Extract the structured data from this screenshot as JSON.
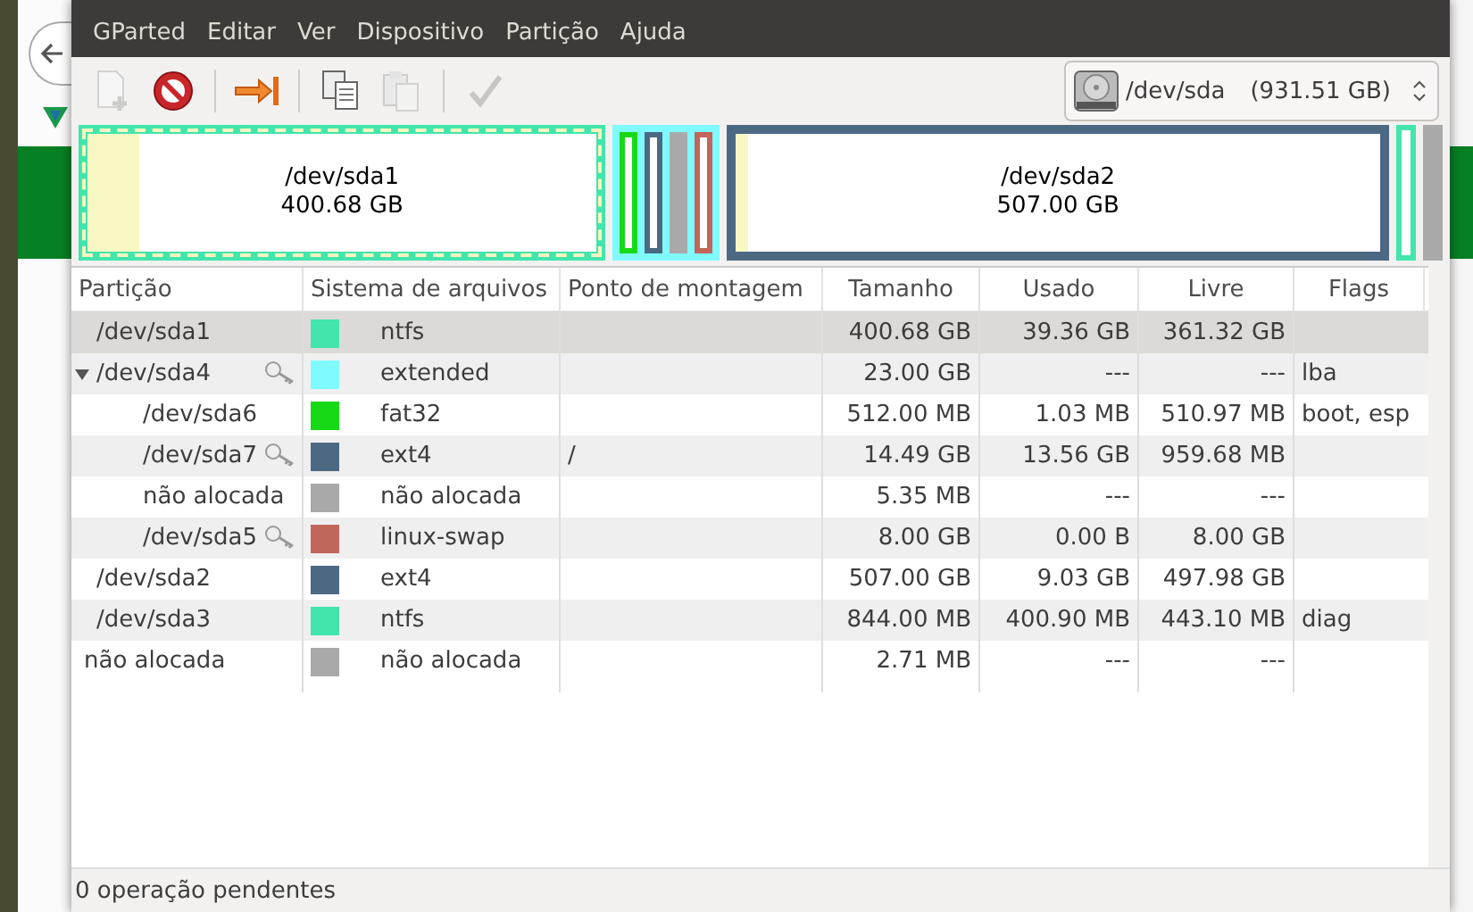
{
  "menu": [
    "GParted",
    "Editar",
    "Ver",
    "Dispositivo",
    "Partição",
    "Ajuda"
  ],
  "toolbar": [
    {
      "kind": "new",
      "disabled": true
    },
    {
      "kind": "delete",
      "disabled": false
    },
    {
      "kind": "sep"
    },
    {
      "kind": "resize",
      "disabled": false
    },
    {
      "kind": "sep"
    },
    {
      "kind": "copy",
      "disabled": false
    },
    {
      "kind": "paste",
      "disabled": true
    },
    {
      "kind": "sep"
    },
    {
      "kind": "apply",
      "disabled": true
    }
  ],
  "device": {
    "name": "/dev/sda",
    "size": "(931.51 GB)"
  },
  "graph": [
    {
      "kind": "partition",
      "label": "/dev/sda1",
      "size": "400.68 GB",
      "color": "#42e5ac",
      "level": 0.1,
      "selected": true
    },
    {
      "kind": "extended",
      "color": "#7ffbff",
      "children": [
        {
          "kind": "slot",
          "color": "#18d918"
        },
        {
          "kind": "slot",
          "color": "#4b6983"
        },
        {
          "kind": "unallocated",
          "color": "#a9a9a9"
        },
        {
          "kind": "slot",
          "color": "#c1665a"
        }
      ]
    },
    {
      "kind": "partition",
      "label": "/dev/sda2",
      "size": "507.00 GB",
      "color": "#4b6983",
      "level": 0.02,
      "selected": false
    },
    {
      "kind": "slot",
      "color": "#42e5ac"
    },
    {
      "kind": "unallocated",
      "color": "#a9a9a9"
    }
  ],
  "table": {
    "columns": [
      "Partição",
      "Sistema de arquivos",
      "Ponto de montagem",
      "Tamanho",
      "Usado",
      "Livre",
      "Flags"
    ],
    "rows": [
      {
        "partition": "/dev/sda1",
        "busy": false,
        "color": "#42e5ac",
        "filesystem": "ntfs",
        "size": "400.68 GB",
        "used": "39.36 GB",
        "free": "361.32 GB",
        "selected": true
      },
      {
        "partition": "/dev/sda4",
        "busy": true,
        "color": "#7ffbff",
        "filesystem": "extended",
        "size": "23.00 GB",
        "used": "---",
        "free": "---",
        "flags": "lba",
        "selected": false,
        "expanded": true,
        "children": [
          {
            "partition": "/dev/sda6",
            "busy": false,
            "color": "#18d918",
            "filesystem": "fat32",
            "size": "512.00 MB",
            "used": "1.03 MB",
            "free": "510.97 MB",
            "flags": "boot, esp",
            "selected": false
          },
          {
            "partition": "/dev/sda7",
            "busy": true,
            "color": "#4b6983",
            "filesystem": "ext4",
            "mount": "/",
            "size": "14.49 GB",
            "used": "13.56 GB",
            "free": "959.68 MB",
            "selected": false
          },
          {
            "partition": "não alocada",
            "busy": false,
            "color": "#a9a9a9",
            "filesystem": "não alocada",
            "size": "5.35 MB",
            "used": "---",
            "free": "---",
            "selected": false
          },
          {
            "partition": "/dev/sda5",
            "busy": true,
            "color": "#c1665a",
            "filesystem": "linux-swap",
            "size": "8.00 GB",
            "used": "0.00 B",
            "free": "8.00 GB",
            "selected": false
          }
        ]
      },
      {
        "partition": "/dev/sda2",
        "busy": false,
        "color": "#4b6983",
        "filesystem": "ext4",
        "size": "507.00 GB",
        "used": "9.03 GB",
        "free": "497.98 GB",
        "selected": false
      },
      {
        "partition": "/dev/sda3",
        "busy": false,
        "color": "#42e5ac",
        "filesystem": "ntfs",
        "size": "844.00 MB",
        "used": "400.90 MB",
        "free": "443.10 MB",
        "flags": "diag",
        "selected": false
      },
      {
        "partition": "não alocada",
        "busy": false,
        "color": "#a9a9a9",
        "filesystem": "não alocada",
        "size": "2.71 MB",
        "used": "---",
        "free": "---",
        "selected": false
      }
    ]
  },
  "status_bar": "0 operação pendentes"
}
